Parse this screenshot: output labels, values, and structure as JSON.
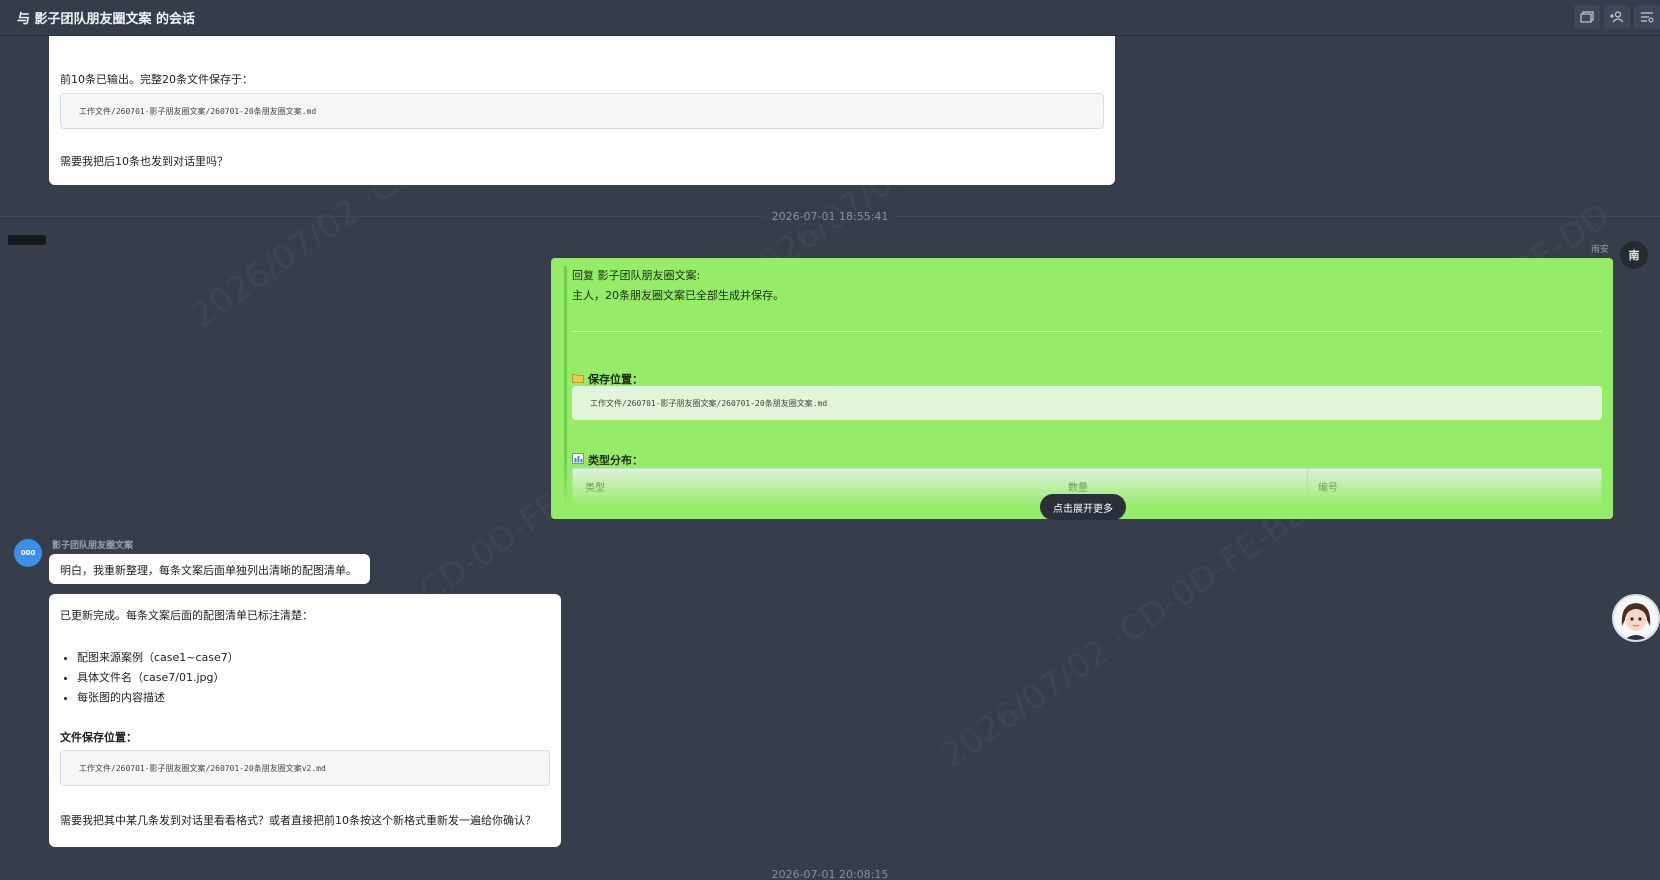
{
  "header": {
    "title": "与 影子团队朋友圈文案 的会话"
  },
  "toolbar": {
    "icons": [
      "window-icon",
      "add-member-icon",
      "menu-icon"
    ]
  },
  "messages": {
    "m1": {
      "line1": "前10条已输出。完整20条文件保存于：",
      "path": "工作文件/260701-影子朋友圈文案/260701-20条朋友圈文案.md",
      "line2": "需要我把后10条也发到对话里吗？"
    },
    "time1": "2026-07-01 18:55:41",
    "user_reply": {
      "sender": "雨安",
      "avatar_text": "南",
      "quote_header": "回复 影子团队朋友圈文案:",
      "line1": "主人，20条朋友圈文案已全部生成并保存。",
      "save_label": "保存位置：",
      "path": "工作文件/260701-影子朋友圈文案/260701-20条朋友圈文案.md",
      "types_label": "类型分布：",
      "table_headers": [
        "类型",
        "数量",
        "编号"
      ],
      "expand": "点击展开更多"
    },
    "bot": {
      "name": "影子团队朋友圈文案",
      "avatar_text": "000",
      "short": "明白，我重新整理，每条文案后面单独列出清晰的配图清单。",
      "intro": "已更新完成。每条文案后面的配图清单已标注清楚：",
      "bullets": [
        "配图来源案例（case1~case7）",
        "具体文件名（case7/01.jpg）",
        "每张图的内容描述"
      ],
      "save_heading": "文件保存位置：",
      "path": "工作文件/260701-影子朋友圈文案/260701-20条朋友圈文案v2.md",
      "question": "需要我把其中某几条发到对话里看看格式？或者直接把前10条按这个新格式重新发一遍给你确认？"
    },
    "time2": "2026-07-01 20:08:15"
  },
  "colors": {
    "bg": "#363d4b",
    "user_bubble": "#95ec69",
    "bot_bubble": "#ffffff"
  }
}
